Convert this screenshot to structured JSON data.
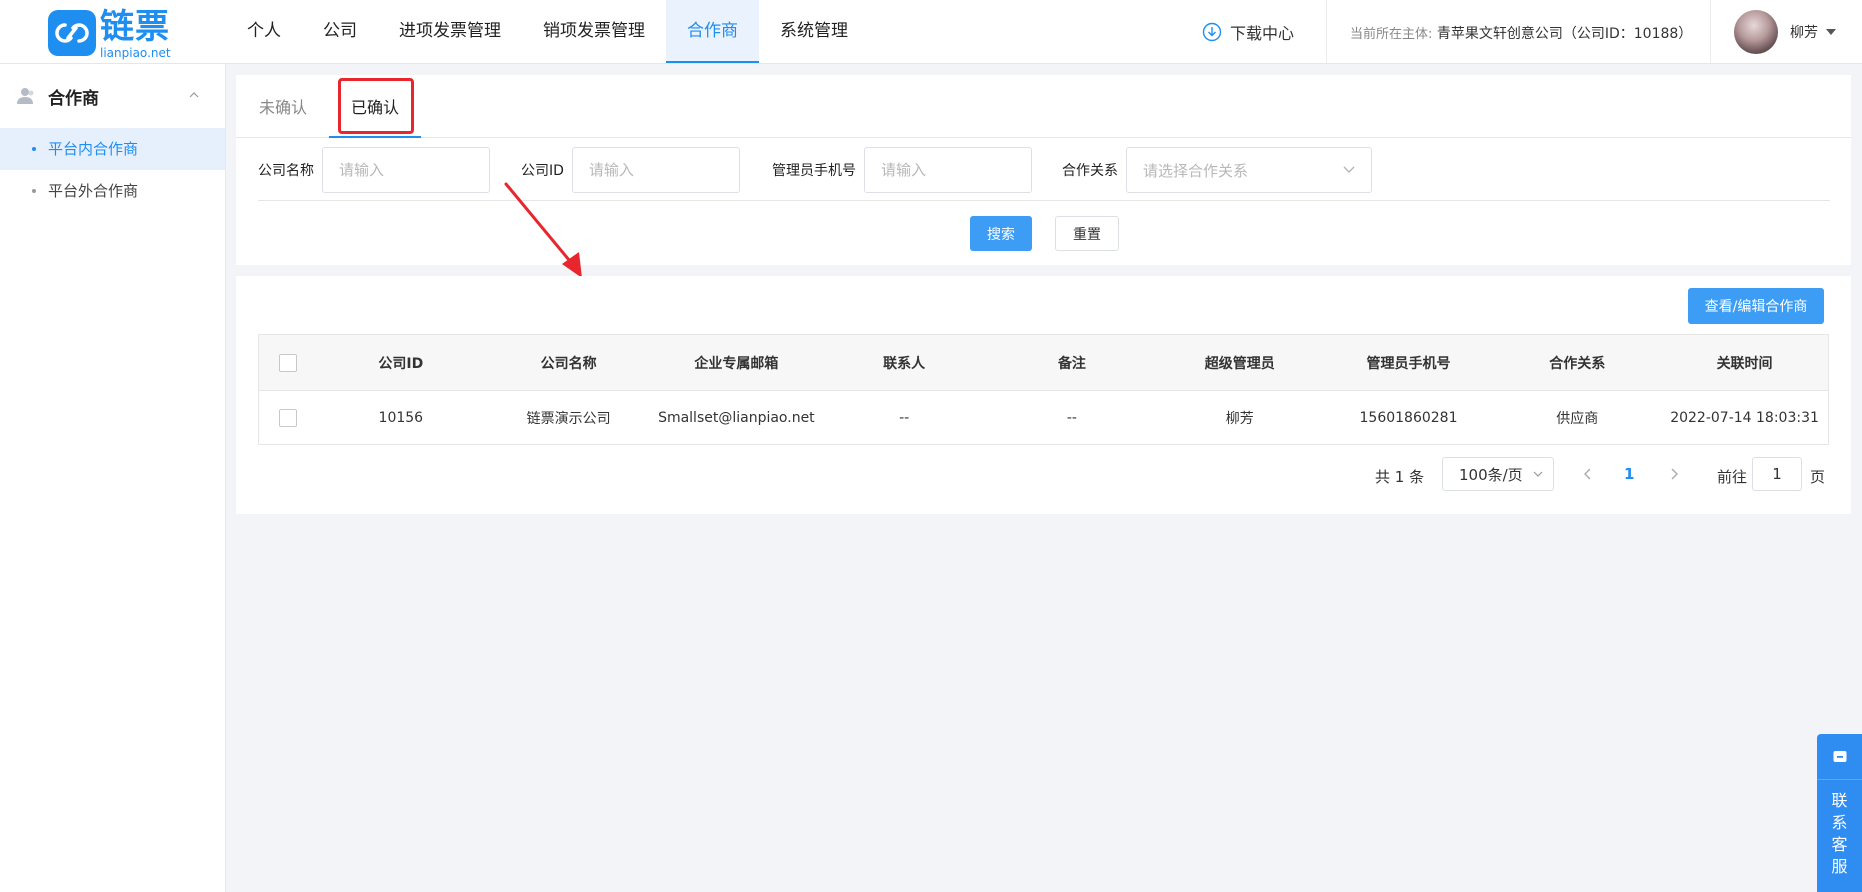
{
  "brand": {
    "name_cn": "链票",
    "name_en": "lianpiao.net",
    "color": "#1f8ef1"
  },
  "nav": [
    {
      "label": "个人",
      "active": false
    },
    {
      "label": "公司",
      "active": false
    },
    {
      "label": "进项发票管理",
      "active": false
    },
    {
      "label": "销项发票管理",
      "active": false
    },
    {
      "label": "合作商",
      "active": true
    },
    {
      "label": "系统管理",
      "active": false
    }
  ],
  "header": {
    "download_label": "下载中心",
    "entity_label": "当前所在主体:",
    "entity_value": "青苹果文轩创意公司（公司ID：10188）",
    "user_name": "柳芳"
  },
  "sidebar": {
    "group_title": "合作商",
    "items": [
      {
        "label": "平台内合作商",
        "active": true
      },
      {
        "label": "平台外合作商",
        "active": false
      }
    ]
  },
  "tabs": [
    {
      "label": "未确认",
      "active": false
    },
    {
      "label": "已确认",
      "active": true
    }
  ],
  "filters": {
    "company_name": {
      "label": "公司名称",
      "placeholder": "请输入"
    },
    "company_id": {
      "label": "公司ID",
      "placeholder": "请输入"
    },
    "admin_phone": {
      "label": "管理员手机号",
      "placeholder": "请输入"
    },
    "relation": {
      "label": "合作关系",
      "placeholder": "请选择合作关系"
    },
    "search_label": "搜索",
    "reset_label": "重置"
  },
  "table": {
    "action_label": "查看/编辑合作商",
    "columns": [
      "公司ID",
      "公司名称",
      "企业专属邮箱",
      "联系人",
      "备注",
      "超级管理员",
      "管理员手机号",
      "合作关系",
      "关联时间"
    ],
    "rows": [
      [
        "10156",
        "链票演示公司",
        "Smallset@lianpiao.net",
        "--",
        "--",
        "柳芳",
        "15601860281",
        "供应商",
        "2022-07-14 18:03:31"
      ]
    ]
  },
  "pagination": {
    "total_text": "共 1 条",
    "page_size": "100条/页",
    "current_page": "1",
    "goto_label": "前往",
    "goto_value": "1",
    "page_suffix": "页"
  },
  "service": {
    "label": "联系客服"
  },
  "colors": {
    "primary": "#1f8ef1",
    "button": "#3d9df5",
    "annotation": "#e8262d"
  }
}
